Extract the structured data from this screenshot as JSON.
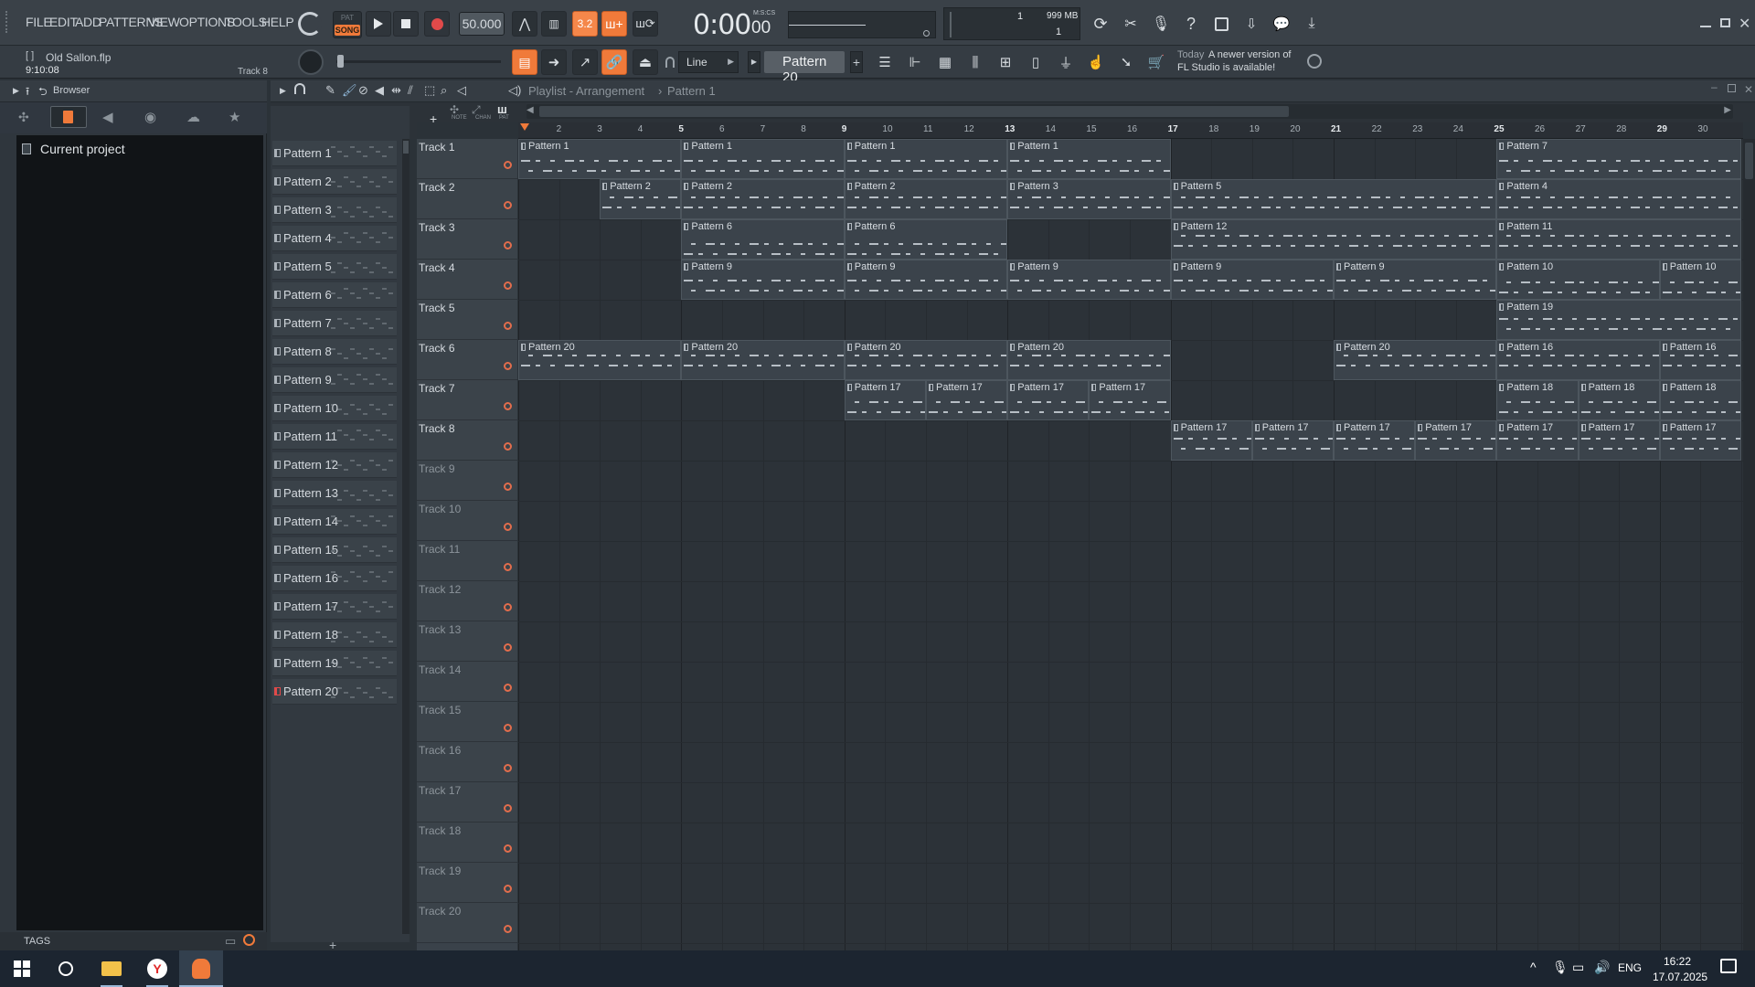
{
  "menu": [
    "FILE",
    "EDIT",
    "ADD",
    "PATTERNS",
    "VIEW",
    "OPTIONS",
    "TOOLS",
    "HELP"
  ],
  "transport": {
    "mode_top": "PAT",
    "mode_bottom": "SONG",
    "tempo": "50.000",
    "time": "0:00",
    "time_sub": "00",
    "time_unit": "M:S:CS",
    "cpu_num": "1",
    "mem": "999 MB",
    "poly": "1"
  },
  "project": {
    "file": "Old Sallon.flp",
    "time": "9:10:08",
    "track_hint": "Track 8"
  },
  "snap": "Line",
  "current_pattern": "Pattern 20",
  "news": {
    "date": "Today",
    "text1": "A newer version of",
    "text2": "FL Studio is available!"
  },
  "browser": {
    "title": "Browser",
    "item": "Current project",
    "tags": "TAGS"
  },
  "playlist": {
    "title": "Playlist - Arrangement",
    "sep": "›",
    "pattern": "Pattern 1",
    "tool_labels": [
      "NOTE",
      "CHAN",
      "PAT"
    ]
  },
  "patterns": [
    "Pattern 1",
    "Pattern 2",
    "Pattern 3",
    "Pattern 4",
    "Pattern 5",
    "Pattern 6",
    "Pattern 7",
    "Pattern 8",
    "Pattern 9",
    "Pattern 10",
    "Pattern 11",
    "Pattern 12",
    "Pattern 13",
    "Pattern 14",
    "Pattern 15",
    "Pattern 16",
    "Pattern 17",
    "Pattern 18",
    "Pattern 19",
    "Pattern 20"
  ],
  "bars": [
    "2",
    "3",
    "4",
    "5",
    "6",
    "7",
    "8",
    "9",
    "10",
    "11",
    "12",
    "13",
    "14",
    "15",
    "16",
    "17",
    "18",
    "19",
    "20",
    "21",
    "22",
    "23",
    "24",
    "25",
    "26",
    "27",
    "28",
    "29",
    "30"
  ],
  "tracks": [
    "Track 1",
    "Track 2",
    "Track 3",
    "Track 4",
    "Track 5",
    "Track 6",
    "Track 7",
    "Track 8",
    "Track 9",
    "Track 10",
    "Track 11",
    "Track 12",
    "Track 13",
    "Track 14",
    "Track 15",
    "Track 16",
    "Track 17",
    "Track 18",
    "Track 19",
    "Track 20"
  ],
  "clips": [
    {
      "track": 0,
      "bar": 1,
      "len": 4,
      "name": "Pattern 1"
    },
    {
      "track": 0,
      "bar": 5,
      "len": 4,
      "name": "Pattern 1"
    },
    {
      "track": 0,
      "bar": 9,
      "len": 4,
      "name": "Pattern 1"
    },
    {
      "track": 0,
      "bar": 13,
      "len": 4,
      "name": "Pattern 1"
    },
    {
      "track": 0,
      "bar": 25,
      "len": 6,
      "name": "Pattern 7"
    },
    {
      "track": 1,
      "bar": 3,
      "len": 2,
      "name": "Pattern 2"
    },
    {
      "track": 1,
      "bar": 5,
      "len": 4,
      "name": "Pattern 2"
    },
    {
      "track": 1,
      "bar": 9,
      "len": 4,
      "name": "Pattern 2"
    },
    {
      "track": 1,
      "bar": 13,
      "len": 4,
      "name": "Pattern 3"
    },
    {
      "track": 1,
      "bar": 17,
      "len": 8,
      "name": "Pattern 5"
    },
    {
      "track": 1,
      "bar": 25,
      "len": 6,
      "name": "Pattern 4"
    },
    {
      "track": 2,
      "bar": 5,
      "len": 4,
      "name": "Pattern 6"
    },
    {
      "track": 2,
      "bar": 9,
      "len": 4,
      "name": "Pattern 6"
    },
    {
      "track": 2,
      "bar": 17,
      "len": 8,
      "name": "Pattern 12"
    },
    {
      "track": 2,
      "bar": 25,
      "len": 6,
      "name": "Pattern 11"
    },
    {
      "track": 3,
      "bar": 5,
      "len": 4,
      "name": "Pattern 9"
    },
    {
      "track": 3,
      "bar": 9,
      "len": 4,
      "name": "Pattern 9"
    },
    {
      "track": 3,
      "bar": 13,
      "len": 4,
      "name": "Pattern 9"
    },
    {
      "track": 3,
      "bar": 17,
      "len": 4,
      "name": "Pattern 9"
    },
    {
      "track": 3,
      "bar": 21,
      "len": 4,
      "name": "Pattern 9"
    },
    {
      "track": 3,
      "bar": 25,
      "len": 4,
      "name": "Pattern 10"
    },
    {
      "track": 3,
      "bar": 29,
      "len": 2,
      "name": "Pattern 10"
    },
    {
      "track": 4,
      "bar": 25,
      "len": 6,
      "name": "Pattern 19"
    },
    {
      "track": 5,
      "bar": 1,
      "len": 4,
      "name": "Pattern 20"
    },
    {
      "track": 5,
      "bar": 5,
      "len": 4,
      "name": "Pattern 20"
    },
    {
      "track": 5,
      "bar": 9,
      "len": 4,
      "name": "Pattern 20"
    },
    {
      "track": 5,
      "bar": 13,
      "len": 4,
      "name": "Pattern 20"
    },
    {
      "track": 5,
      "bar": 21,
      "len": 4,
      "name": "Pattern 20"
    },
    {
      "track": 5,
      "bar": 25,
      "len": 4,
      "name": "Pattern 16"
    },
    {
      "track": 5,
      "bar": 29,
      "len": 2,
      "name": "Pattern 16"
    },
    {
      "track": 6,
      "bar": 9,
      "len": 2,
      "name": "Pattern 17"
    },
    {
      "track": 6,
      "bar": 11,
      "len": 2,
      "name": "Pattern 17"
    },
    {
      "track": 6,
      "bar": 13,
      "len": 2,
      "name": "Pattern 17"
    },
    {
      "track": 6,
      "bar": 15,
      "len": 2,
      "name": "Pattern 17"
    },
    {
      "track": 6,
      "bar": 25,
      "len": 2,
      "name": "Pattern 18"
    },
    {
      "track": 6,
      "bar": 27,
      "len": 2,
      "name": "Pattern 18"
    },
    {
      "track": 6,
      "bar": 29,
      "len": 2,
      "name": "Pattern 18"
    },
    {
      "track": 7,
      "bar": 17,
      "len": 2,
      "name": "Pattern 17"
    },
    {
      "track": 7,
      "bar": 19,
      "len": 2,
      "name": "Pattern 17"
    },
    {
      "track": 7,
      "bar": 21,
      "len": 2,
      "name": "Pattern 17"
    },
    {
      "track": 7,
      "bar": 23,
      "len": 2,
      "name": "Pattern 17"
    },
    {
      "track": 7,
      "bar": 25,
      "len": 2,
      "name": "Pattern 17"
    },
    {
      "track": 7,
      "bar": 27,
      "len": 2,
      "name": "Pattern 17"
    },
    {
      "track": 7,
      "bar": 29,
      "len": 2,
      "name": "Pattern 17"
    }
  ],
  "taskbar": {
    "lang": "ENG",
    "time": "16:22",
    "date": "17.07.2025"
  },
  "colors": {
    "accent": "#f07a3a",
    "clip": "#3b434b",
    "bg": "#2c3238"
  }
}
